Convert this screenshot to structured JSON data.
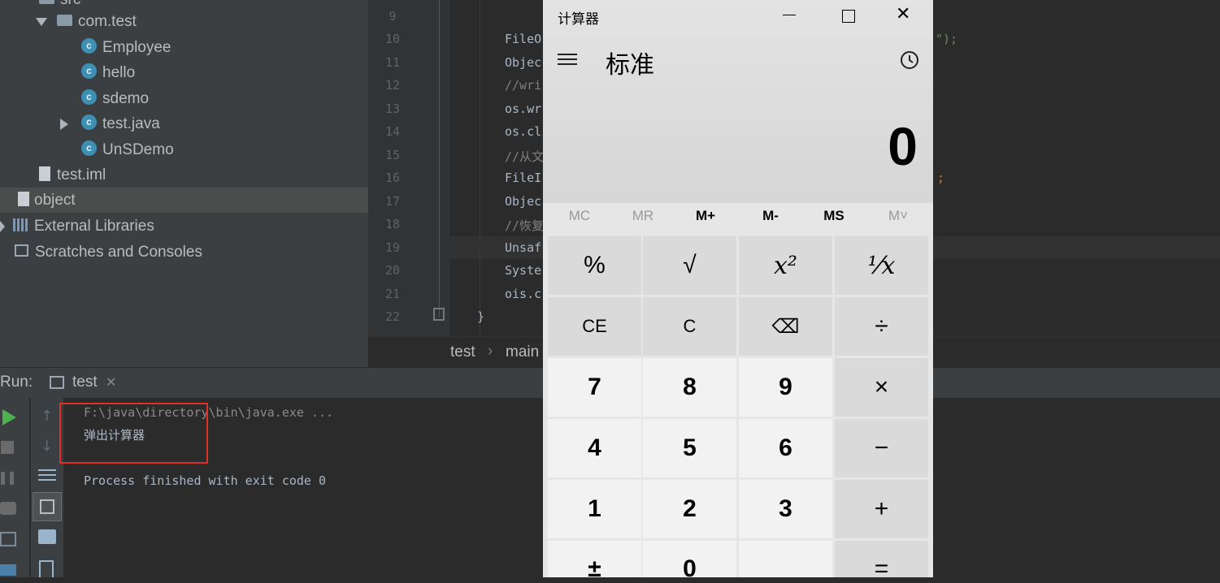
{
  "project_tree": {
    "items": [
      {
        "label": "src"
      },
      {
        "label": "com.test"
      },
      {
        "label": "Employee"
      },
      {
        "label": "hello"
      },
      {
        "label": "sdemo"
      },
      {
        "label": "test.java"
      },
      {
        "label": "UnSDemo"
      },
      {
        "label": "test.iml"
      },
      {
        "label": "object"
      },
      {
        "label": "External Libraries"
      },
      {
        "label": "Scratches and Consoles"
      }
    ]
  },
  "editor": {
    "line_numbers": [
      "9",
      "10",
      "11",
      "12",
      "13",
      "14",
      "15",
      "16",
      "17",
      "18",
      "19",
      "20",
      "21",
      "22"
    ],
    "code_lines": [
      "",
      "FileO",
      "Objec",
      "//wri",
      "os.wr",
      "os.cl",
      "//从文",
      "FileI",
      "Objec",
      "//恢复",
      "Unsaf",
      "Syste",
      "ois.c",
      "}"
    ],
    "right_fragments": {
      "line10": "\");",
      "line16": ";"
    }
  },
  "breadcrumb": {
    "items": [
      "test",
      "main"
    ]
  },
  "run_panel": {
    "title": "Run:",
    "tab_label": "test",
    "console_lines": [
      "F:\\java\\directory\\bin\\java.exe ...",
      "弹出计算器",
      "",
      "Process finished with exit code 0"
    ]
  },
  "calculator": {
    "window_title": "计算器",
    "mode": "标准",
    "display": "0",
    "memory_keys": [
      "MC",
      "MR",
      "M+",
      "M-",
      "MS",
      "M˅"
    ],
    "keypad": [
      [
        "%",
        "√",
        "x²",
        "⅟x"
      ],
      [
        "CE",
        "C",
        "⌫",
        "÷"
      ],
      [
        "7",
        "8",
        "9",
        "×"
      ],
      [
        "4",
        "5",
        "6",
        "−"
      ],
      [
        "1",
        "2",
        "3",
        "+"
      ],
      [
        "±",
        "0",
        "",
        "="
      ]
    ]
  },
  "colors": {
    "ide_background": "#2b2b2b",
    "panel": "#3c3f41",
    "calc_background": "#e6e6e6",
    "highlight_box": "#e0302a"
  }
}
